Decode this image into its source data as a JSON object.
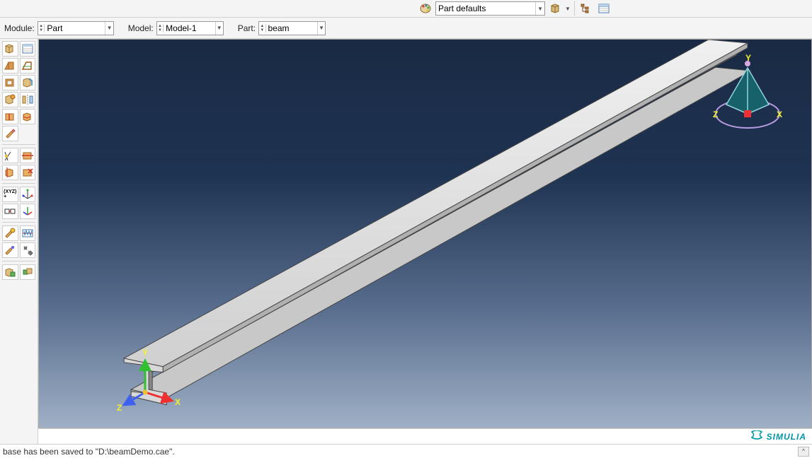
{
  "top_toolbar": {
    "render_style_label": "Part defaults"
  },
  "context": {
    "module_label": "Module:",
    "module_value": "Part",
    "model_label": "Model:",
    "model_value": "Model-1",
    "part_label": "Part:",
    "part_value": "beam"
  },
  "viewport": {
    "axes": {
      "x": "X",
      "y": "Y",
      "z": "Z"
    },
    "viewcube": {
      "x": "X",
      "y": "Y",
      "z": "Z"
    }
  },
  "branding": {
    "name": "SIMULIA"
  },
  "message": {
    "text": "base has been saved to \"D:\\beamDemo.cae\"."
  },
  "tooltips": {
    "palette_icon": "palette-icon",
    "box_icon": "box-icon",
    "dropdown_icon": "dropdown-icon",
    "tree_icon": "tree-icon",
    "grid_icon": "grid-icon"
  }
}
